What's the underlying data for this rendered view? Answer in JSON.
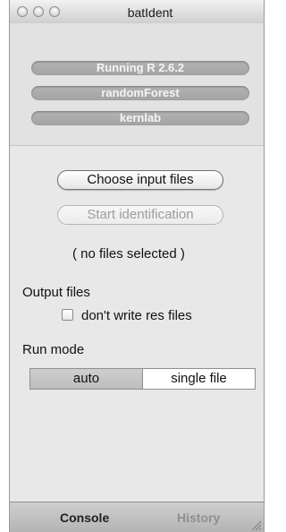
{
  "window": {
    "title": "batIdent"
  },
  "status": {
    "items": [
      "Running R 2.6.2",
      "randomForest",
      "kernlab"
    ]
  },
  "actions": {
    "choose_label": "Choose input files",
    "start_label": "Start identification",
    "selection_status": "( no files selected )"
  },
  "output": {
    "heading": "Output files",
    "checkbox_label": "don't write res files",
    "checkbox_checked": false
  },
  "run_mode": {
    "heading": "Run mode",
    "options": [
      "auto",
      "single file"
    ],
    "selected": "auto"
  },
  "tabs": {
    "items": [
      "Console",
      "History"
    ],
    "active": "Console"
  },
  "colors": {
    "window_bg": "#e8e8e8",
    "status_pill": "#a8a8a8",
    "inactive_text": "#9d9d9d"
  }
}
